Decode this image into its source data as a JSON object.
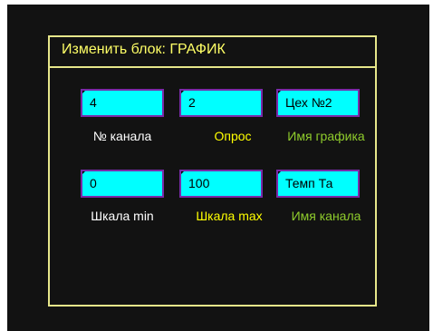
{
  "dialog": {
    "title": "Изменить блок:  ГРАФИК"
  },
  "colors": {
    "field_bg": "#00ffff",
    "field_border": "#7a2aa8",
    "title": "#ffff66",
    "label_white": "#ffffff",
    "label_yellow": "#ffff00",
    "label_green": "#8fcc2c"
  },
  "row1": {
    "fields": [
      {
        "value": "4",
        "label": "№ канала"
      },
      {
        "value": "2",
        "label": "Опрос"
      },
      {
        "value": "Цех №2",
        "label": "Имя графика"
      }
    ]
  },
  "row2": {
    "fields": [
      {
        "value": "0",
        "label": "Шкала min"
      },
      {
        "value": "100",
        "label": "Шкала max"
      },
      {
        "value": "Темп Та",
        "label": "Имя канала"
      }
    ]
  }
}
